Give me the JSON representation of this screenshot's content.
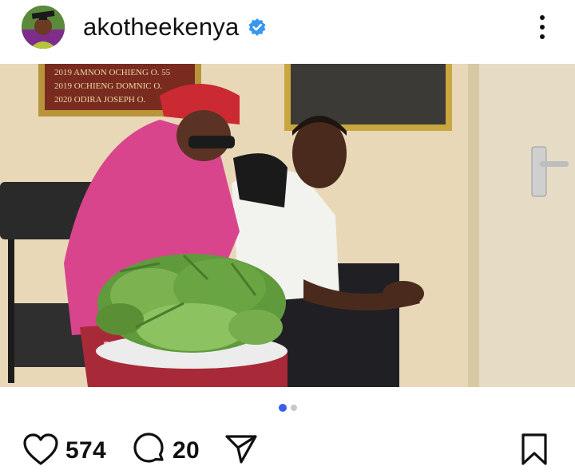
{
  "post": {
    "username": "akotheekenya",
    "verified": true,
    "avatar_icon": "profile-avatar-icon",
    "more_icon": "more-options-icon"
  },
  "photo": {
    "plaque_text": [
      "2019 AMNON OCHIENG O. 55",
      "2019 OCHIENG DOMNIC O.",
      "2020 ODIRA JOSEPH O."
    ]
  },
  "carousel": {
    "total": 2,
    "active_index": 0
  },
  "actions": {
    "likes": "574",
    "comments": "20",
    "like_icon": "heart-icon",
    "comment_icon": "comment-bubble-icon",
    "share_icon": "send-icon",
    "save_icon": "bookmark-icon"
  },
  "colors": {
    "verified_blue": "#3897f0",
    "dot_active": "#3b5ee8",
    "dot_inactive": "#c8c8c8"
  }
}
